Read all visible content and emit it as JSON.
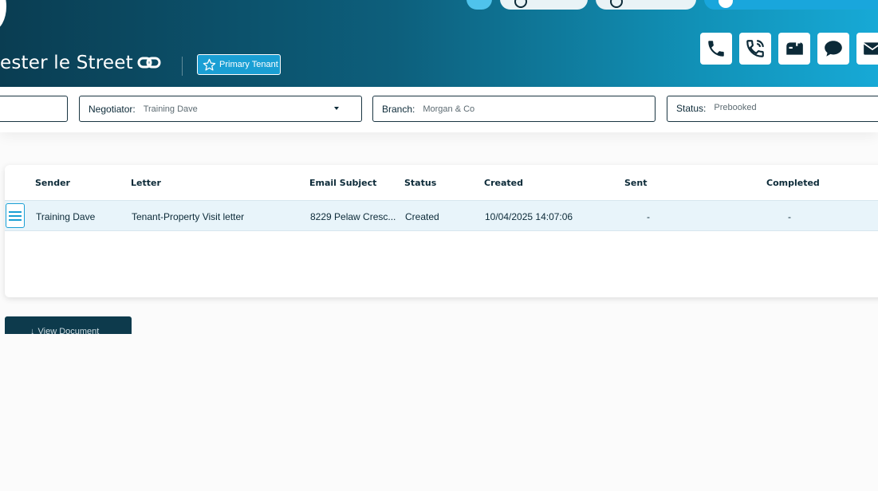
{
  "header": {
    "title": "ester le Street",
    "badge_label": "Primary Tenant"
  },
  "filters": {
    "negotiator_label": "Negotiator:",
    "negotiator_value": "Training Dave",
    "branch_label": "Branch:",
    "branch_value": "Morgan & Co",
    "status_label": "Status:",
    "status_value": "Prebooked"
  },
  "table": {
    "columns": [
      "Sender",
      "Letter",
      "Email Subject",
      "Status",
      "Created",
      "Sent",
      "Completed"
    ],
    "rows": [
      {
        "sender": "Training Dave",
        "letter": "Tenant-Property Visit letter",
        "email_subject": "8229 Pelaw Cresc...",
        "status": "Created",
        "created": "10/04/2025 14:07:06",
        "sent": "-",
        "completed": "-"
      }
    ]
  },
  "actions": {
    "view_document_label": "View Document"
  },
  "colors": {
    "accent": "#1a9fd4",
    "dark": "#0d3a4c",
    "row_highlight": "#e8f4fa"
  }
}
